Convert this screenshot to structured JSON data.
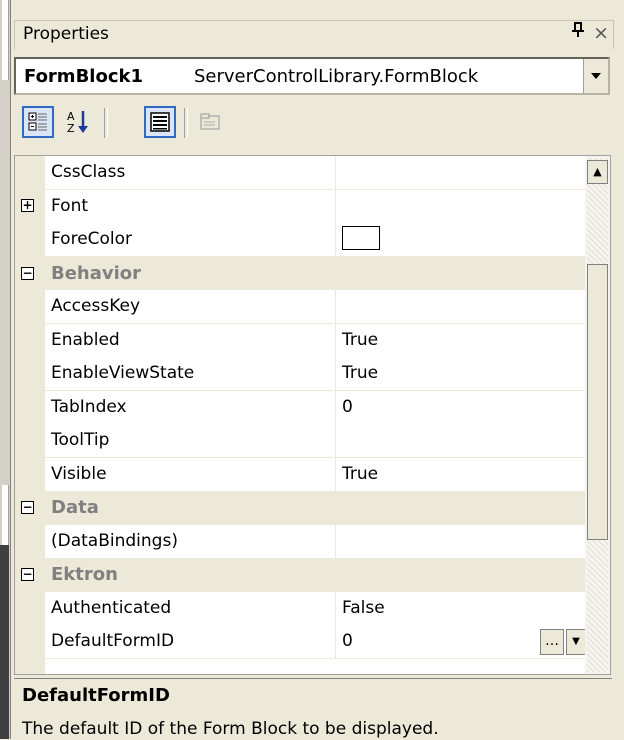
{
  "window": {
    "title": "Properties",
    "pin_glyph": "†",
    "close_glyph": "×"
  },
  "selector": {
    "object_name": "FormBlock1",
    "object_type": "ServerControlLibrary.FormBlock"
  },
  "toolbar": {
    "buttons": [
      "categorized",
      "alphabetical",
      "properties",
      "property-pages"
    ]
  },
  "grid": {
    "rows": [
      {
        "kind": "prop",
        "name": "CssClass",
        "value": ""
      },
      {
        "kind": "prop",
        "name": "Font",
        "value": "",
        "expander": "+"
      },
      {
        "kind": "prop",
        "name": "ForeColor",
        "value": "",
        "swatch": "#ffffff"
      },
      {
        "kind": "cat",
        "name": "Behavior",
        "expander": "−"
      },
      {
        "kind": "prop",
        "name": "AccessKey",
        "value": ""
      },
      {
        "kind": "prop",
        "name": "Enabled",
        "value": "True"
      },
      {
        "kind": "prop",
        "name": "EnableViewState",
        "value": "True"
      },
      {
        "kind": "prop",
        "name": "TabIndex",
        "value": "0"
      },
      {
        "kind": "prop",
        "name": "ToolTip",
        "value": ""
      },
      {
        "kind": "prop",
        "name": "Visible",
        "value": "True"
      },
      {
        "kind": "cat",
        "name": "Data",
        "expander": "−"
      },
      {
        "kind": "prop",
        "name": "(DataBindings)",
        "value": ""
      },
      {
        "kind": "cat",
        "name": "Ektron",
        "expander": "−"
      },
      {
        "kind": "prop",
        "name": "Authenticated",
        "value": "False"
      },
      {
        "kind": "prop",
        "name": "DefaultFormID",
        "value": "0",
        "selected": true
      }
    ]
  },
  "description": {
    "heading": "DefaultFormID",
    "text": "The default ID of the Form Block to be displayed."
  },
  "colors": {
    "panel_bg": "#ece9d8",
    "selection": "#316ac5",
    "category_text": "#808080"
  }
}
